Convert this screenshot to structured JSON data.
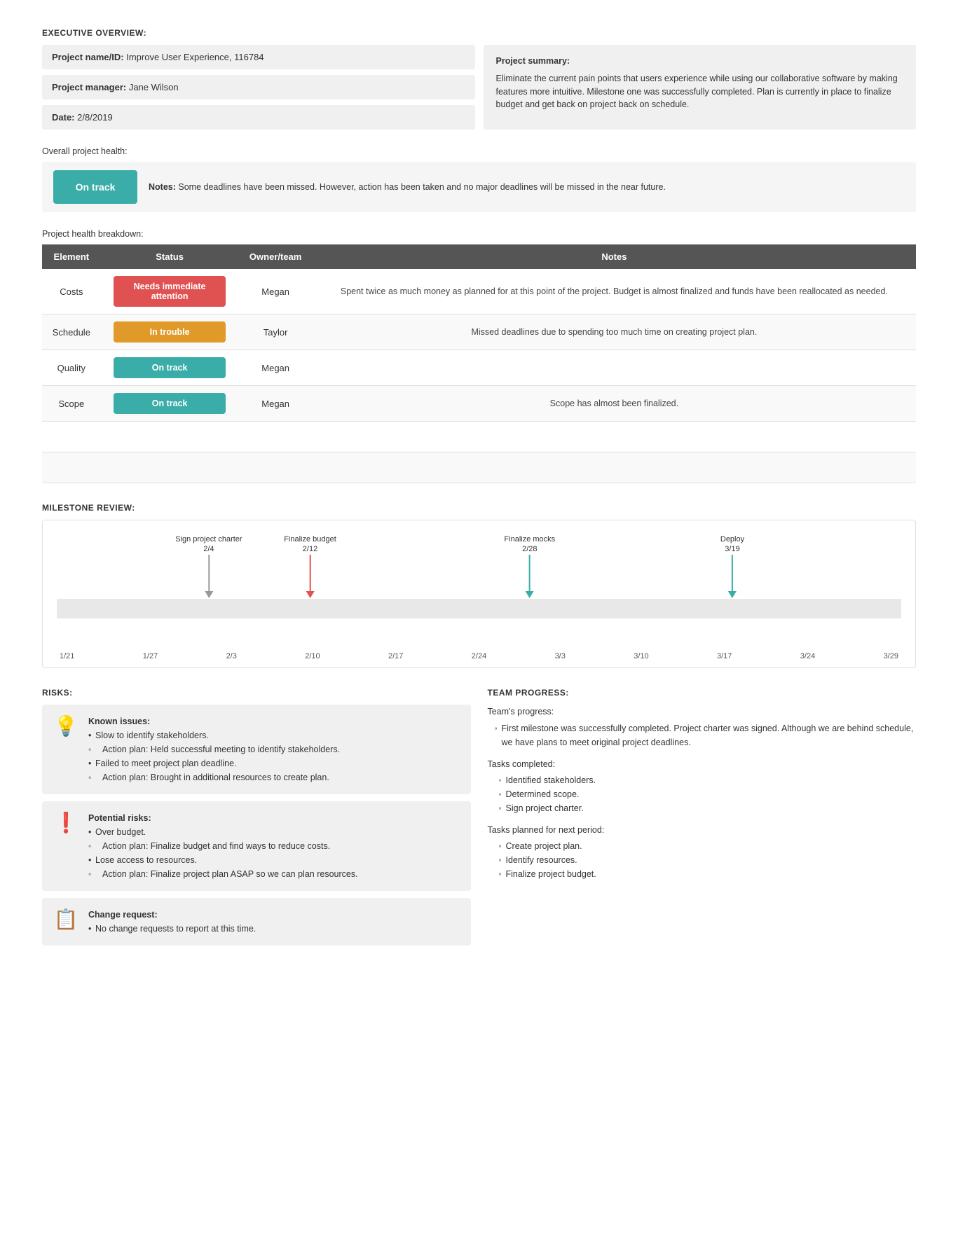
{
  "executive_overview": {
    "section_title": "EXECUTIVE OVERVIEW:",
    "project_name_label": "Project name/ID:",
    "project_name_value": "Improve User Experience, 116784",
    "project_manager_label": "Project manager:",
    "project_manager_value": "Jane Wilson",
    "date_label": "Date:",
    "date_value": "2/8/2019",
    "project_summary_label": "Project summary:",
    "project_summary_text": "Eliminate the current pain points that users experience while using our collaborative software by making features more intuitive. Milestone one was successfully completed. Plan is currently in place to finalize budget and get back on project back on schedule."
  },
  "overall_health": {
    "label": "Overall project health:",
    "badge": "On track",
    "notes_label": "Notes:",
    "notes_text": "Some deadlines have been missed. However, action has been taken and no major deadlines will be missed in the near future."
  },
  "breakdown": {
    "section_title": "Project health breakdown:",
    "columns": [
      "Element",
      "Status",
      "Owner/team",
      "Notes"
    ],
    "rows": [
      {
        "element": "Costs",
        "status": "Needs immediate attention",
        "status_class": "badge-red",
        "owner": "Megan",
        "notes": "Spent twice as much money as planned for at this point of the project. Budget is almost finalized and funds have been reallocated as needed."
      },
      {
        "element": "Schedule",
        "status": "In trouble",
        "status_class": "badge-orange",
        "owner": "Taylor",
        "notes": "Missed deadlines due to spending too much time on creating project plan."
      },
      {
        "element": "Quality",
        "status": "On track",
        "status_class": "badge-teal",
        "owner": "Megan",
        "notes": ""
      },
      {
        "element": "Scope",
        "status": "On track",
        "status_class": "badge-teal",
        "owner": "Megan",
        "notes": "Scope has almost been finalized."
      },
      {
        "element": "",
        "status": "",
        "status_class": "",
        "owner": "",
        "notes": ""
      },
      {
        "element": "",
        "status": "",
        "status_class": "",
        "owner": "",
        "notes": ""
      }
    ]
  },
  "milestone_review": {
    "section_title": "MILESTONE REVIEW:",
    "milestones": [
      {
        "label": "Sign project charter",
        "date": "2/4",
        "color": "gray",
        "left_pct": 18
      },
      {
        "label": "Finalize budget",
        "date": "2/12",
        "color": "red",
        "left_pct": 30
      },
      {
        "label": "Finalize mocks",
        "date": "2/28",
        "color": "teal",
        "left_pct": 56
      },
      {
        "label": "Deploy",
        "date": "3/19",
        "color": "teal",
        "left_pct": 80
      }
    ],
    "x_axis": [
      "1/21",
      "1/27",
      "2/3",
      "2/10",
      "2/17",
      "2/24",
      "3/3",
      "3/10",
      "3/17",
      "3/24",
      "3/29"
    ]
  },
  "risks": {
    "section_title": "RISKS:",
    "items": [
      {
        "icon": "💡",
        "title": "Known issues:",
        "points": [
          "Slow to identify stakeholders.",
          "Action plan: Held successful meeting to identify stakeholders.",
          "Failed to meet project plan deadline.",
          "Action plan: Brought in additional resources to create plan."
        ],
        "sub_indices": [
          1,
          3
        ]
      },
      {
        "icon": "❗",
        "title": "Potential risks:",
        "points": [
          "Over budget.",
          "Action plan: Finalize budget and find ways to reduce costs.",
          "Lose access to resources.",
          "Action plan: Finalize project plan ASAP so we can plan resources."
        ],
        "sub_indices": [
          1,
          3
        ]
      },
      {
        "icon": "📋",
        "title": "Change request:",
        "points": [
          "No change requests to report at this time."
        ],
        "sub_indices": []
      }
    ]
  },
  "team_progress": {
    "section_title": "TEAM PROGRESS:",
    "progress_label": "Team's progress:",
    "progress_text": "First milestone was successfully completed. Project charter was signed. Although we are behind schedule, we have plans to meet original project deadlines.",
    "completed_label": "Tasks completed:",
    "completed_tasks": [
      "Identified stakeholders.",
      "Determined scope.",
      "Sign project charter."
    ],
    "planned_label": "Tasks planned for next period:",
    "planned_tasks": [
      "Create project plan.",
      "Identify resources.",
      "Finalize project budget."
    ]
  }
}
